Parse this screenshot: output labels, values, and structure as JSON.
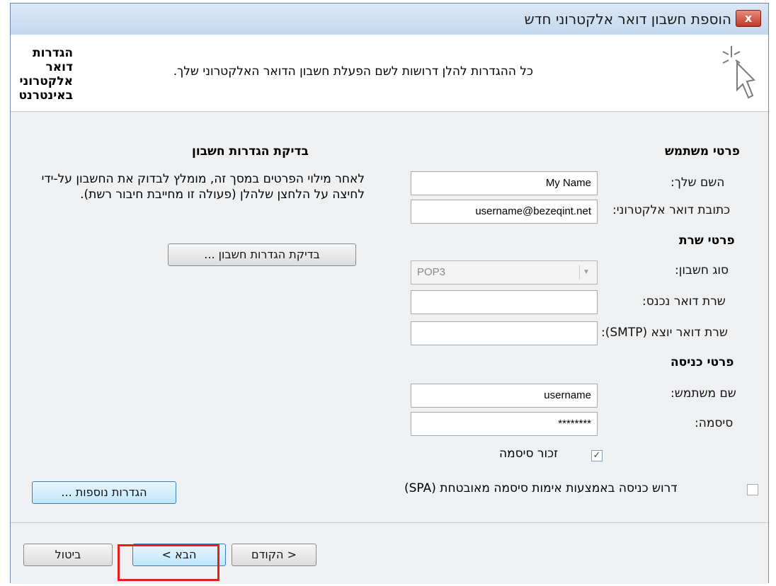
{
  "window": {
    "title": "הוספת חשבון דואר אלקטרוני חדש",
    "close_label": "x"
  },
  "header": {
    "title": "הגדרות דואר אלקטרוני באינטרנט",
    "description": "כל ההגדרות להלן דרושות לשם הפעלת חשבון הדואר האלקטרוני שלך."
  },
  "user_info": {
    "section": "פרטי משתמש",
    "name_label": "השם שלך:",
    "name_value": "My Name",
    "email_label": "כתובת דואר אלקטרוני:",
    "email_value": "username@bezeqint.net"
  },
  "server_info": {
    "section": "פרטי שרת",
    "account_type_label": "סוג חשבון:",
    "account_type_value": "POP3",
    "incoming_label": "שרת דואר נכנס:",
    "incoming_value": "",
    "outgoing_label": "שרת דואר יוצא (SMTP):",
    "outgoing_value": ""
  },
  "login_info": {
    "section": "פרטי כניסה",
    "username_label": "שם משתמש:",
    "username_value": "username",
    "password_label": "סיסמה:",
    "password_value": "********",
    "remember_label": "זכור סיסמה",
    "remember_checked": true,
    "spa_label": "דרוש כניסה באמצעות אימות סיסמה מאובטחת (SPA)",
    "spa_checked": false
  },
  "test_settings": {
    "section": "בדיקת הגדרות חשבון",
    "description": "לאחר מילוי הפרטים במסך זה, מומלץ לבדוק את החשבון על-ידי לחיצה על הלחצן שלהלן (פעולה זו מחייבת חיבור רשת).",
    "test_button": "בדיקת הגדרות חשבון ...",
    "more_settings_button": "הגדרות נוספות ..."
  },
  "footer": {
    "back_button": "< הקודם",
    "next_button": "הבא >",
    "cancel_button": "ביטול"
  },
  "colors": {
    "highlight": "#e2201b",
    "accent": "#3c7fb1"
  }
}
